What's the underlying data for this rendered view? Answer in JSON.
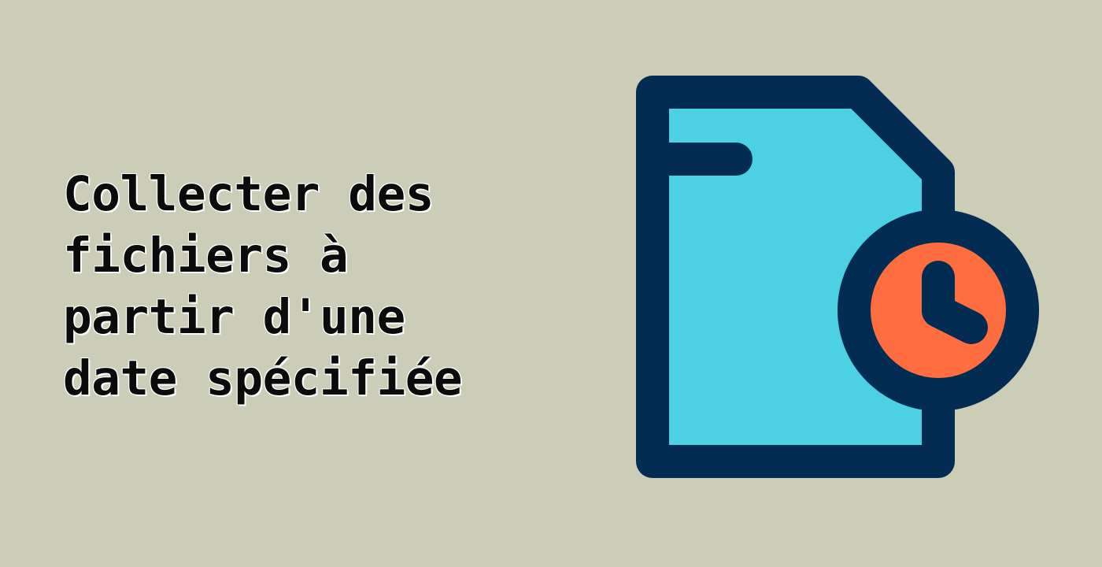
{
  "title": {
    "lines": [
      "Collecter des",
      "fichiers à",
      "partir d'une",
      "date spécifiée"
    ]
  },
  "illustration": {
    "icon": "file-clock-icon",
    "colors": {
      "background": "#cccdb7",
      "outline": "#022c51",
      "page_fill": "#4cd0e3",
      "clock_face": "#ff6e41"
    }
  }
}
